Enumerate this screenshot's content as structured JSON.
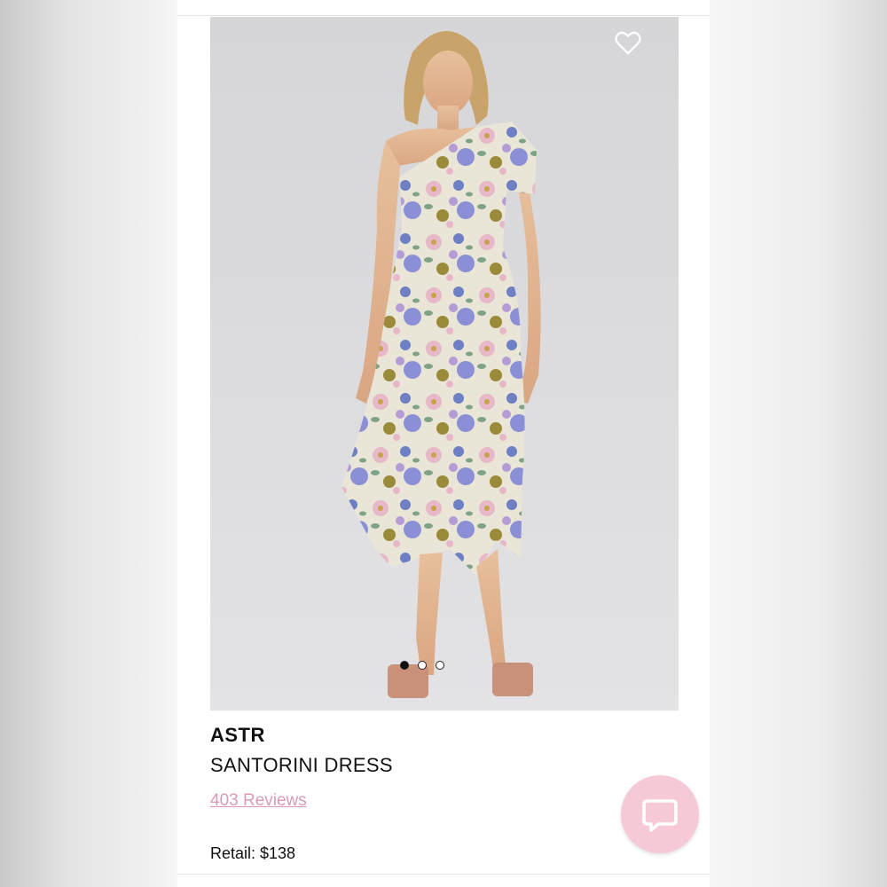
{
  "product": {
    "brand": "ASTR",
    "name": "SANTORINI DRESS",
    "reviews_link": "403 Reviews",
    "retail_label": "Retail: $138"
  },
  "gallery": {
    "image_count": 3,
    "active_index": 0
  },
  "icons": {
    "favorite": "heart-outline-icon",
    "chat": "chat-bubble-icon"
  },
  "colors": {
    "reviews_link": "#d99ab8",
    "chat_button": "#f5c9d5",
    "text": "#111111"
  }
}
